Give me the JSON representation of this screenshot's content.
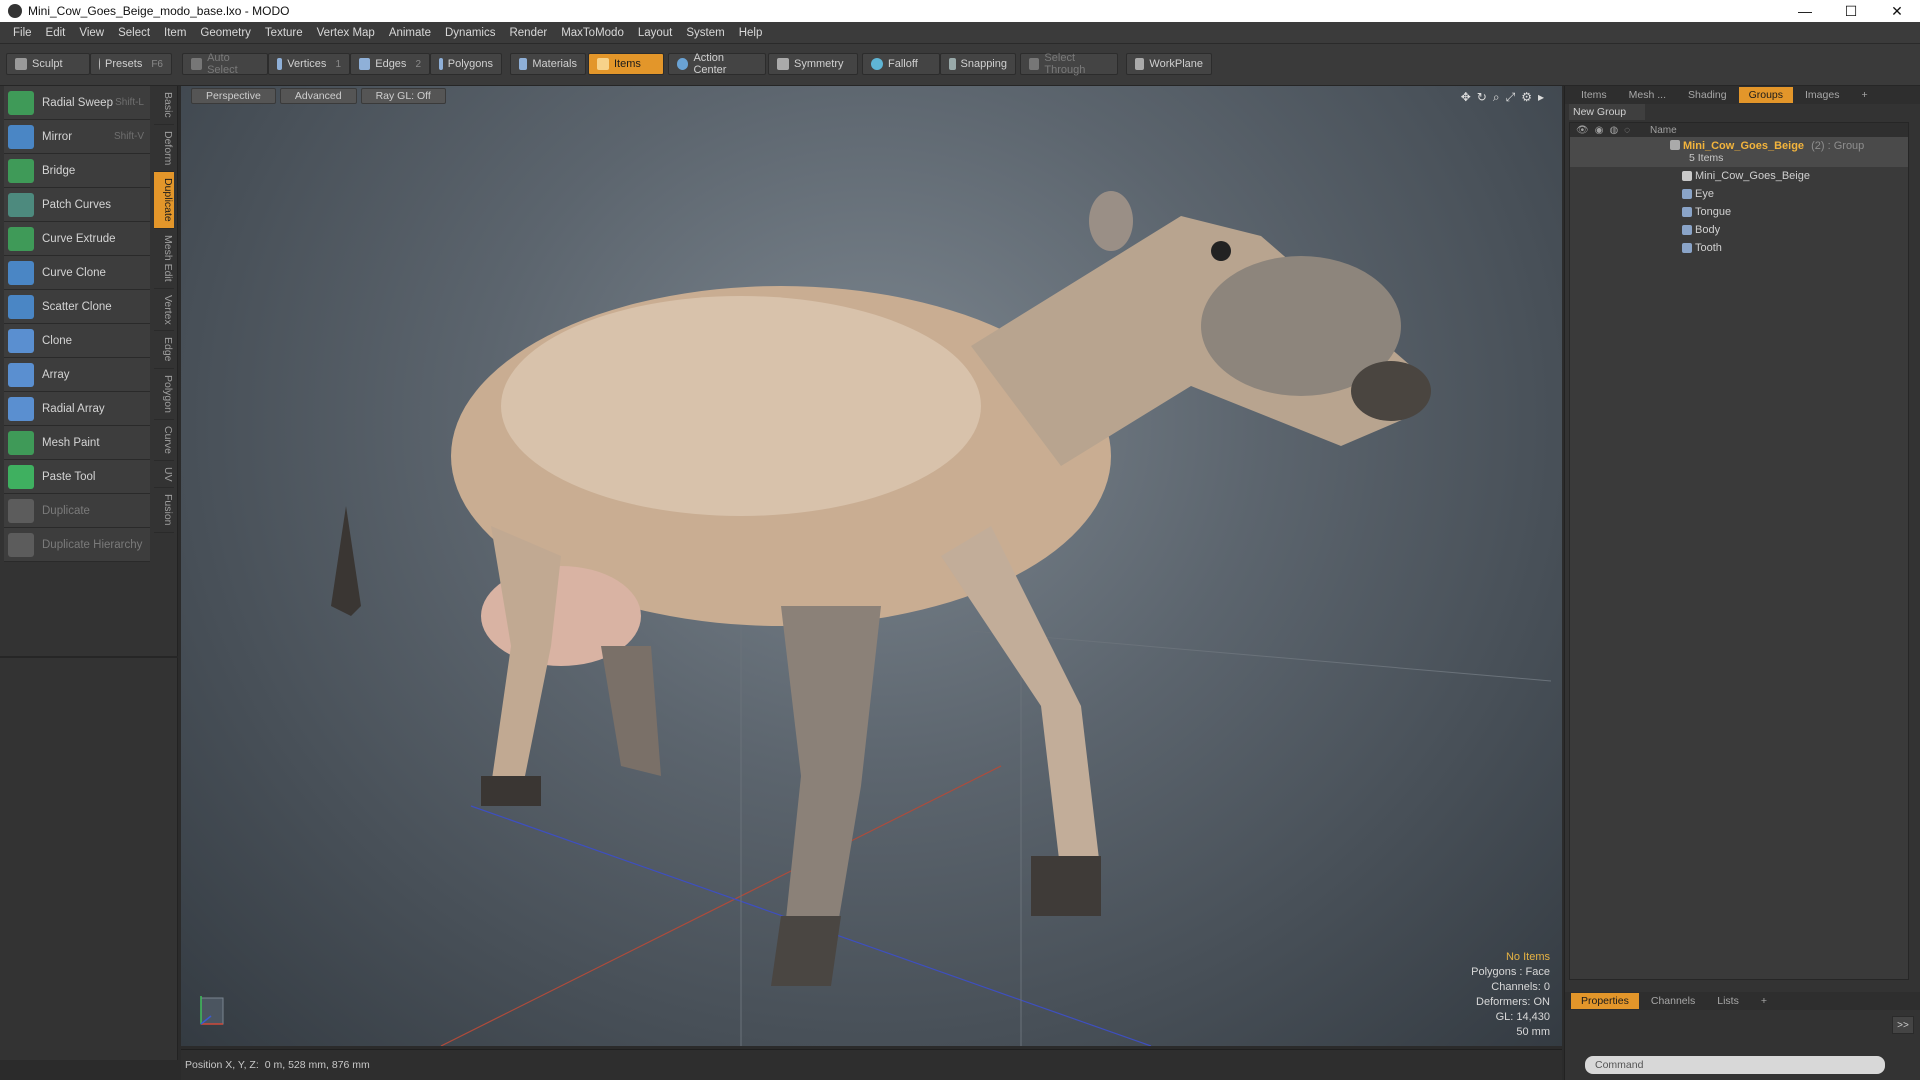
{
  "window": {
    "title": "Mini_Cow_Goes_Beige_modo_base.lxo - MODO",
    "controls": [
      "—",
      "☐",
      "✕"
    ]
  },
  "menu": [
    "File",
    "Edit",
    "View",
    "Select",
    "Item",
    "Geometry",
    "Texture",
    "Vertex Map",
    "Animate",
    "Dynamics",
    "Render",
    "MaxToModo",
    "Layout",
    "System",
    "Help"
  ],
  "toolbar": {
    "sculpt": "Sculpt",
    "presets": "Presets",
    "presets_key": "F6",
    "auto_select": "Auto Select",
    "vertices": "Vertices",
    "vertices_count": "1",
    "edges": "Edges",
    "edges_count": "2",
    "polygons": "Polygons",
    "materials": "Materials",
    "items": "Items",
    "action_center": "Action Center",
    "symmetry": "Symmetry",
    "falloff": "Falloff",
    "snapping": "Snapping",
    "select_through": "Select Through",
    "workplane": "WorkPlane"
  },
  "tools": [
    {
      "label": "Radial Sweep",
      "shortcut": "Shift-L"
    },
    {
      "label": "Mirror",
      "shortcut": "Shift-V"
    },
    {
      "label": "Bridge",
      "shortcut": ""
    },
    {
      "label": "Patch Curves",
      "shortcut": ""
    },
    {
      "label": "Curve Extrude",
      "shortcut": ""
    },
    {
      "label": "Curve Clone",
      "shortcut": ""
    },
    {
      "label": "Scatter Clone",
      "shortcut": ""
    },
    {
      "label": "Clone",
      "shortcut": ""
    },
    {
      "label": "Array",
      "shortcut": ""
    },
    {
      "label": "Radial Array",
      "shortcut": ""
    },
    {
      "label": "Mesh Paint",
      "shortcut": ""
    },
    {
      "label": "Paste Tool",
      "shortcut": ""
    },
    {
      "label": "Duplicate",
      "shortcut": ""
    },
    {
      "label": "Duplicate Hierarchy",
      "shortcut": ""
    }
  ],
  "vtabs": [
    "Basic",
    "Deform",
    "Duplicate",
    "Mesh Edit",
    "Vertex",
    "Edge",
    "Polygon",
    "Curve",
    "UV",
    "Fusion"
  ],
  "viewport": {
    "tabs": [
      "Perspective",
      "Advanced",
      "Ray GL: Off"
    ],
    "stats": {
      "items": "No Items",
      "polygons": "Polygons : Face",
      "channels": "Channels: 0",
      "deformers": "Deformers: ON",
      "gl": "GL: 14,430",
      "focal": "50 mm"
    }
  },
  "right_panel": {
    "tabs": [
      "Items",
      "Mesh ...",
      "Shading",
      "Groups",
      "Images",
      "+"
    ],
    "new_group": "New Group",
    "name_header": "Name",
    "group": {
      "name": "Mini_Cow_Goes_Beige",
      "meta": "(2) : Group",
      "count": "5 Items"
    },
    "children": [
      "Mini_Cow_Goes_Beige",
      "Eye",
      "Tongue",
      "Body",
      "Tooth"
    ],
    "bottom_tabs": [
      "Properties",
      "Channels",
      "Lists",
      "+"
    ],
    "command_placeholder": "Command",
    "expand": ">>"
  },
  "status": {
    "label": "Position X, Y, Z:",
    "value": "0 m, 528 mm, 876 mm"
  }
}
